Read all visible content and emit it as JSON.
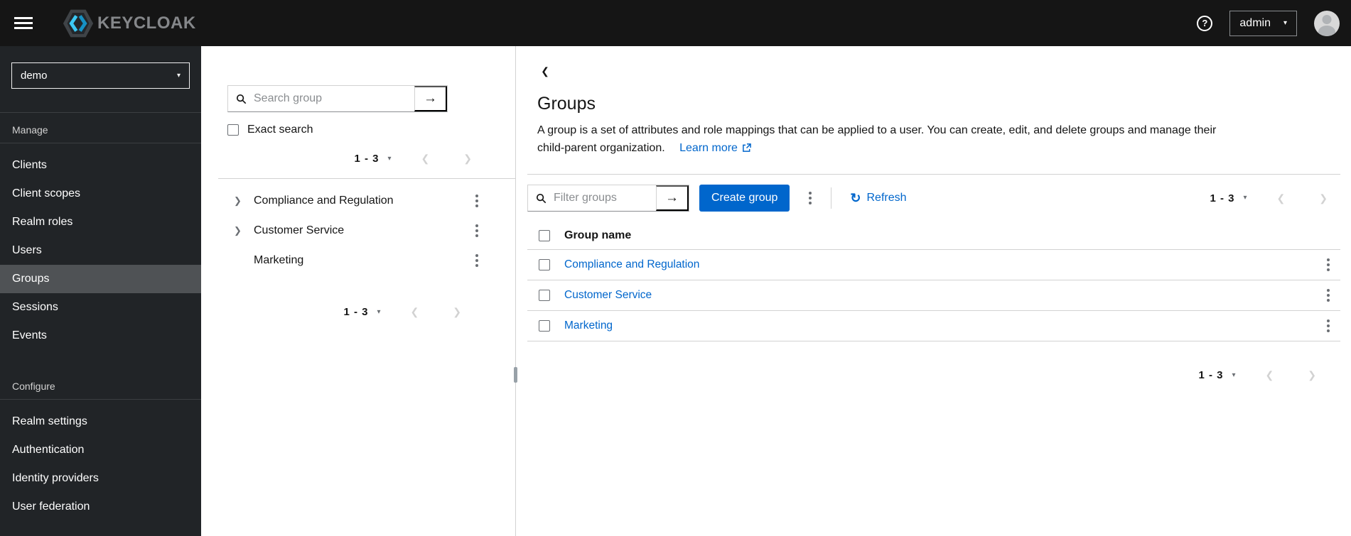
{
  "masthead": {
    "brand": "KEYCLOAK",
    "user": "admin"
  },
  "icons": {
    "help": "?",
    "caret_down": "▾",
    "arrow": "→",
    "back": "❮",
    "prev": "❮",
    "next": "❯",
    "chevron_right": "❯",
    "refresh": "↻"
  },
  "sidebar": {
    "realm": "demo",
    "sections": [
      {
        "label": "Manage",
        "items": [
          {
            "label": "Clients"
          },
          {
            "label": "Client scopes"
          },
          {
            "label": "Realm roles"
          },
          {
            "label": "Users"
          },
          {
            "label": "Groups"
          },
          {
            "label": "Sessions"
          },
          {
            "label": "Events"
          }
        ]
      },
      {
        "label": "Configure",
        "items": [
          {
            "label": "Realm settings"
          },
          {
            "label": "Authentication"
          },
          {
            "label": "Identity providers"
          },
          {
            "label": "User federation"
          }
        ]
      }
    ]
  },
  "tree": {
    "search_placeholder": "Search group",
    "exact_search": "Exact search",
    "pagination_top": "1 - 3",
    "pagination_bottom": "1 - 3",
    "groups": [
      {
        "name": "Compliance and Regulation",
        "expandable": true
      },
      {
        "name": "Customer Service",
        "expandable": true
      },
      {
        "name": "Marketing",
        "expandable": false
      }
    ]
  },
  "main": {
    "title": "Groups",
    "description_line1": "A group is a set of attributes and role mappings that can be applied to a user. You can create, edit, and delete groups and manage their",
    "description_line2": "child-parent organization.",
    "learn_more": "Learn more",
    "toolbar": {
      "filter_placeholder": "Filter groups",
      "create_label": "Create group",
      "refresh_label": "Refresh",
      "pagination": "1 - 3"
    },
    "table": {
      "header": "Group name",
      "rows": [
        {
          "name": "Compliance and Regulation"
        },
        {
          "name": "Customer Service"
        },
        {
          "name": "Marketing"
        }
      ]
    },
    "pagination_bottom": "1 - 3"
  },
  "colors": {
    "accent": "#0066cc",
    "link": "#0066cc",
    "masthead_bg": "#151515",
    "sidebar_bg": "#212427",
    "sidebar_selected_bg": "#4f5255",
    "logo_cyan": "#3cc9f5",
    "border": "#d2d2d2"
  }
}
